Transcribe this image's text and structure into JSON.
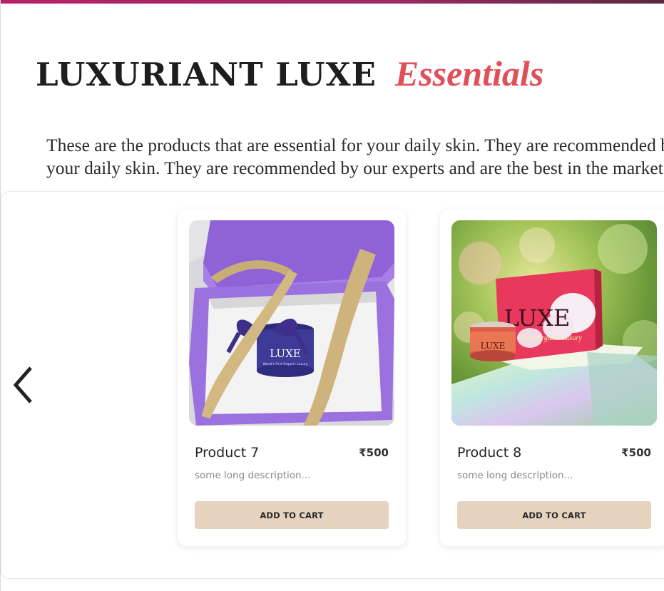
{
  "heading": {
    "main": "LUXURIANT LUXE",
    "accent": "Essentials"
  },
  "intro": {
    "line1": "These are the products that are essential for your daily skin. They are recommended by our experts and are the best in the market.",
    "line2": "your daily skin. They are recommended by our experts and are the best in the market."
  },
  "carousel": {
    "prev_icon": "chevron-left-icon",
    "products": [
      {
        "name": "Product 7",
        "price": "₹500",
        "description": "some long description...",
        "button_label": "ADD TO CART",
        "image_logo": "LUXE",
        "image_tagline": "World's First Organic Luxury"
      },
      {
        "name": "Product 8",
        "price": "₹500",
        "description": "some long description...",
        "button_label": "ADD TO CART",
        "image_logo": "LUXE",
        "image_tagline": "First Organic Luxury"
      }
    ]
  },
  "colors": {
    "accent": "#e0505a",
    "button_bg": "#e5d3bf",
    "top_bar": "#b81f6a"
  }
}
